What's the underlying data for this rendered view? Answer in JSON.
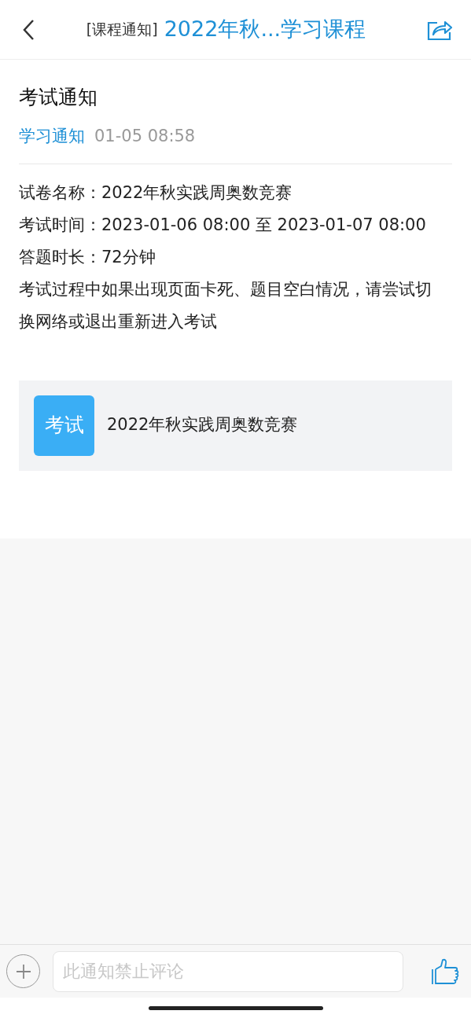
{
  "header": {
    "category": "[课程通知]",
    "title": "2022年秋...学习课程"
  },
  "notice": {
    "title": "考试通知",
    "tag": "学习通知",
    "time": "01-05 08:58",
    "paragraphs": [
      "试卷名称：2022年秋实践周奥数竞赛",
      "考试时间：2023-01-06 08:00 至 2023-01-07 08:00",
      "答题时长：72分钟",
      "考试过程中如果出现页面卡死、题目空白情况，请尝试切换网络或退出重新进入考试"
    ]
  },
  "attachment": {
    "badge": "考试",
    "name": "2022年秋实践周奥数竞赛"
  },
  "comment_bar": {
    "placeholder": "此通知禁止评论"
  }
}
